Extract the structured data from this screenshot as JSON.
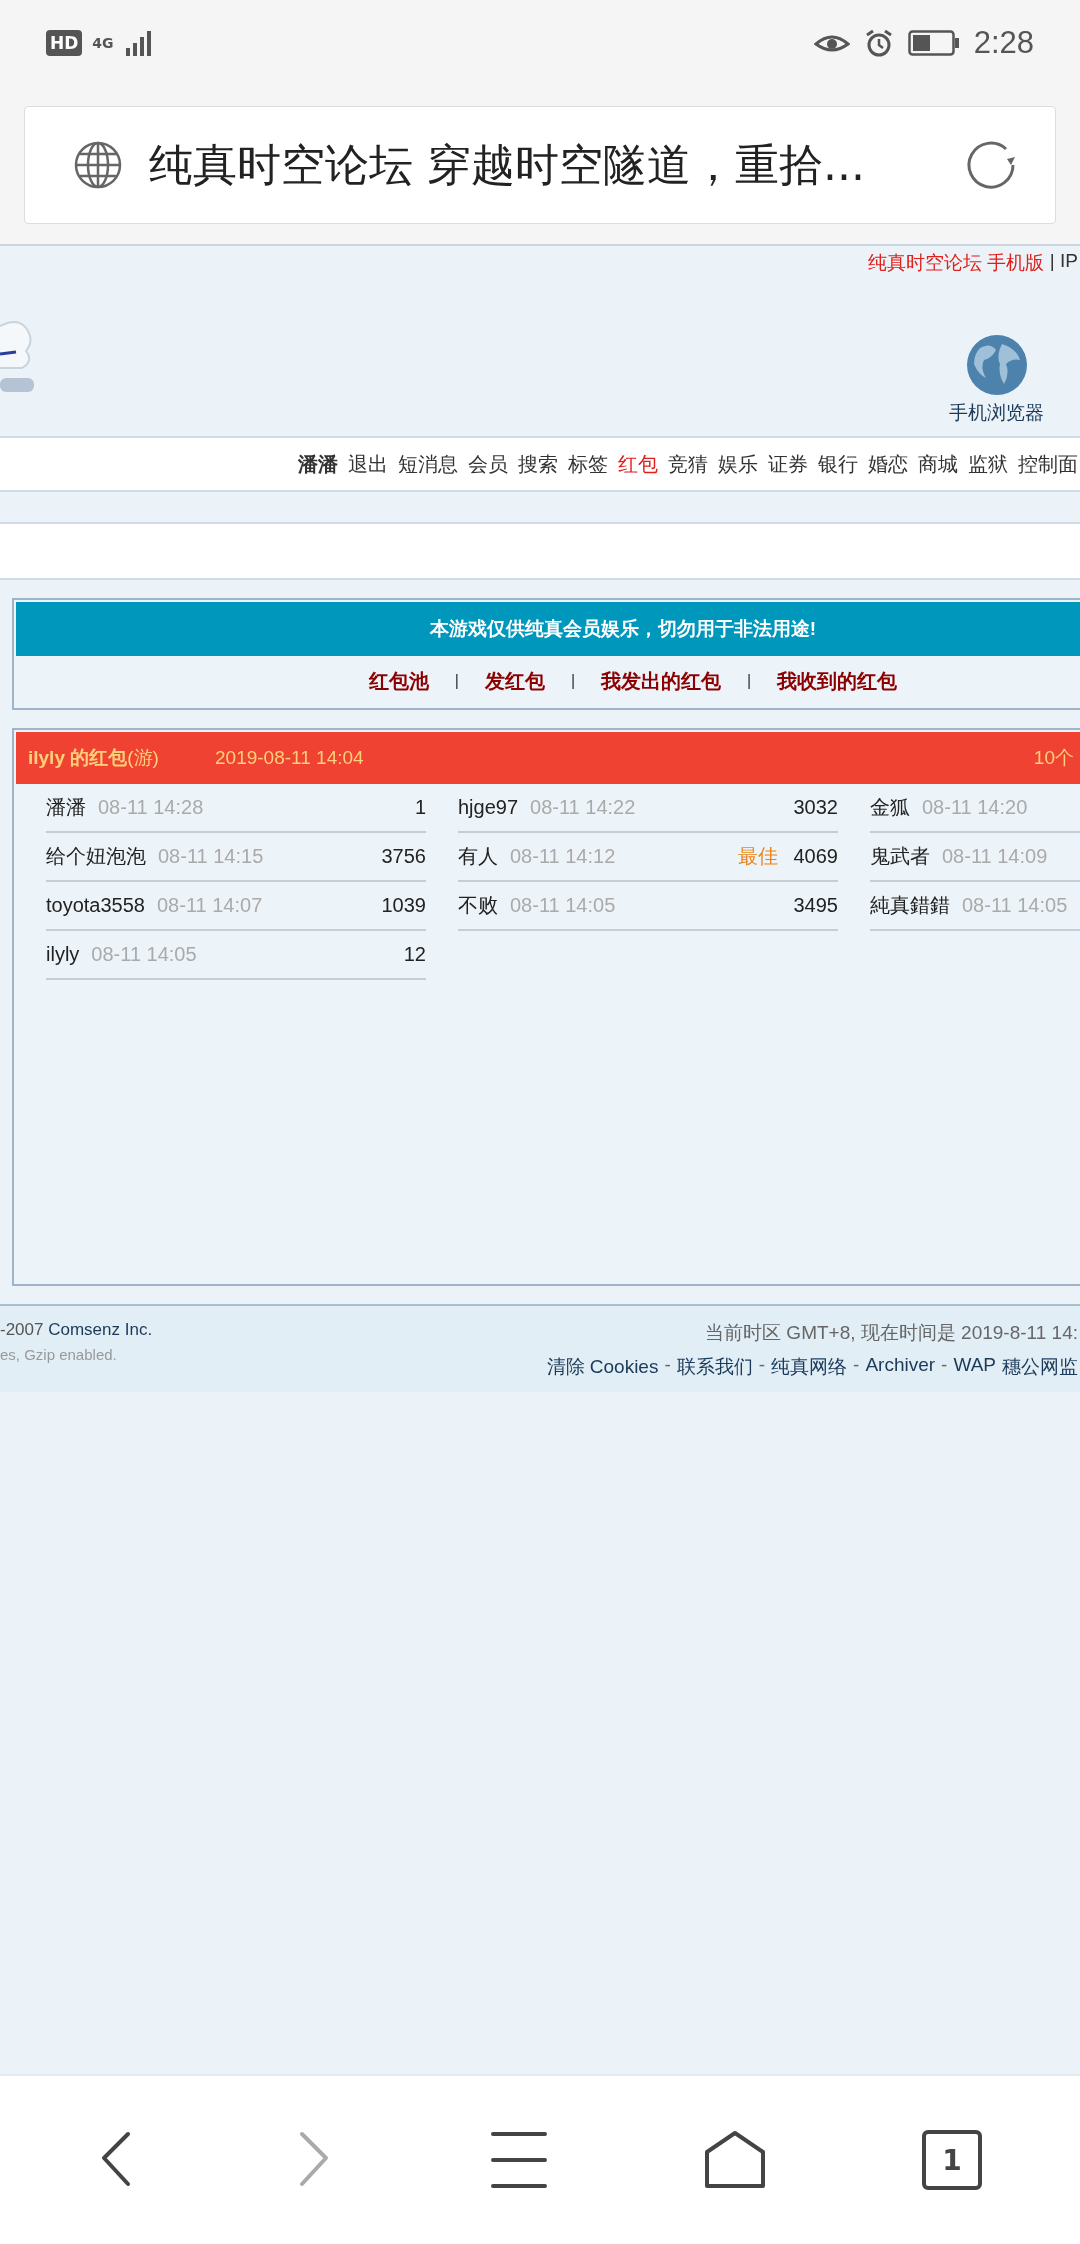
{
  "status_bar": {
    "hd": "HD",
    "network": "4G",
    "time": "2:28"
  },
  "address_bar": {
    "title": "纯真时空论坛 穿越时空隧道，重拾..."
  },
  "header": {
    "top_links": [
      {
        "text": "纯真时空论坛 手机版",
        "kind": "link"
      },
      {
        "text": "| IP",
        "kind": "plain"
      }
    ],
    "mobile_label": "手机浏览器"
  },
  "nav": [
    {
      "label": "潘潘",
      "kind": "user",
      "selected": false
    },
    {
      "label": "退出",
      "kind": "link",
      "selected": false
    },
    {
      "label": "短消息",
      "kind": "link",
      "selected": false
    },
    {
      "label": "会员",
      "kind": "link",
      "selected": false
    },
    {
      "label": "搜索",
      "kind": "link",
      "selected": false
    },
    {
      "label": "标签",
      "kind": "link",
      "selected": false
    },
    {
      "label": "红包",
      "kind": "link",
      "selected": true
    },
    {
      "label": "竞猜",
      "kind": "link",
      "selected": false
    },
    {
      "label": "娱乐",
      "kind": "link",
      "selected": false
    },
    {
      "label": "证券",
      "kind": "link",
      "selected": false
    },
    {
      "label": "银行",
      "kind": "link",
      "selected": false
    },
    {
      "label": "婚恋",
      "kind": "link",
      "selected": false
    },
    {
      "label": "商城",
      "kind": "link",
      "selected": false
    },
    {
      "label": "监狱",
      "kind": "link",
      "selected": false
    },
    {
      "label": "控制面",
      "kind": "link",
      "selected": false
    }
  ],
  "notice": {
    "title": "本游戏仅供纯真会员娱乐，切勿用于非法用途!",
    "links": [
      "红包池",
      "发红包",
      "我发出的红包",
      "我收到的红包"
    ],
    "separator": "|"
  },
  "packet": {
    "owner": "ilyly 的红包",
    "tag": "(游)",
    "date": "2019-08-11 14:04",
    "count": "10个",
    "grabs": [
      {
        "name": "潘潘",
        "time": "08-11 14:28",
        "amount": "1"
      },
      {
        "name": "hjge97",
        "time": "08-11 14:22",
        "amount": "3032"
      },
      {
        "name": "金狐",
        "time": "08-11 14:20"
      },
      {
        "name": "给个妞泡泡",
        "time": "08-11 14:15",
        "amount": "3756"
      },
      {
        "name": "有人",
        "time": "08-11 14:12",
        "amount": "4069",
        "best": "最佳"
      },
      {
        "name": "鬼武者",
        "time": "08-11 14:09"
      },
      {
        "name": "toyota3558",
        "time": "08-11 14:07",
        "amount": "1039"
      },
      {
        "name": "不败",
        "time": "08-11 14:05",
        "amount": "3495"
      },
      {
        "name": "純真錯錯",
        "time": "08-11 14:05"
      },
      {
        "name": "ilyly",
        "time": "08-11 14:05",
        "amount": "12"
      }
    ]
  },
  "footer": {
    "copyright_prefix": "-2007",
    "copyright_company": "Comsenz Inc.",
    "info": "es, Gzip enabled.",
    "timezone": "当前时区 GMT+8, 现在时间是 2019-8-11 14:",
    "links": [
      "清除 Cookies",
      "联系我们",
      "纯真网络",
      "Archiver",
      "WAP"
    ],
    "link_separator": "-",
    "record": "穗公网监"
  },
  "bottom_nav": {
    "tab_count": "1"
  }
}
